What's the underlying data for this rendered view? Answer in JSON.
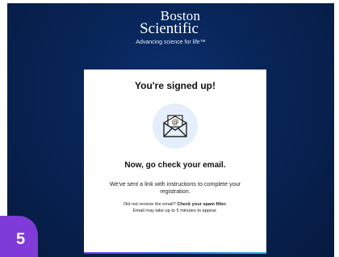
{
  "brand": {
    "logo_line1": "Boston",
    "logo_line2": "Scientific",
    "tagline": "Advancing science for life™"
  },
  "card": {
    "title": "You're signed up!",
    "icon": "envelope-email-icon",
    "subtitle": "Now, go check your email.",
    "body": "We've sent a link with instructions to complete your registration.",
    "spam_prefix": "Did not receive the email?",
    "spam_bold": "Check your spam filter.",
    "delay_note": "Email may take up to 5 minutes to appear."
  },
  "step_badge": "5",
  "colors": {
    "background": "#082456",
    "card": "#ffffff",
    "icon_circle": "#e5eefc",
    "badge": "#7e3bd8"
  }
}
